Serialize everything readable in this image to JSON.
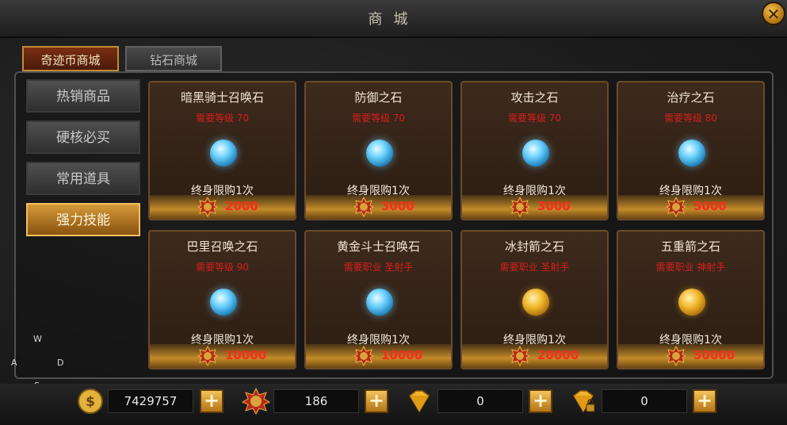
{
  "window": {
    "title": "商城"
  },
  "tabs": [
    {
      "label": "奇迹币商城",
      "active": true
    },
    {
      "label": "钻石商城",
      "active": false
    }
  ],
  "sidebar": {
    "items": [
      {
        "label": "热销商品",
        "active": false
      },
      {
        "label": "硬核必买",
        "active": false
      },
      {
        "label": "常用道具",
        "active": false
      },
      {
        "label": "强力技能",
        "active": true
      }
    ]
  },
  "items": [
    {
      "name": "暗黑骑士召唤石",
      "requirement": "需要等级 70",
      "gem": "blue-gem-icon",
      "limit": "终身限购1次",
      "price": "2000"
    },
    {
      "name": "防御之石",
      "requirement": "需要等级 70",
      "gem": "blue-gem-icon",
      "limit": "终身限购1次",
      "price": "3000"
    },
    {
      "name": "攻击之石",
      "requirement": "需要等级 70",
      "gem": "blue-gem-icon",
      "limit": "终身限购1次",
      "price": "3000"
    },
    {
      "name": "治疗之石",
      "requirement": "需要等级 80",
      "gem": "blue-gem-icon",
      "limit": "终身限购1次",
      "price": "5000"
    },
    {
      "name": "巴里召唤之石",
      "requirement": "需要等级 90",
      "gem": "blue-gem-icon",
      "limit": "终身限购1次",
      "price": "10000"
    },
    {
      "name": "黄金斗士召唤石",
      "requirement": "需要职业 圣射手",
      "gem": "blue-gem-icon",
      "limit": "终身限购1次",
      "price": "10000"
    },
    {
      "name": "冰封箭之石",
      "requirement": "需要职业 圣射手",
      "gem": "gold-gem-icon",
      "limit": "终身限购1次",
      "price": "20000"
    },
    {
      "name": "五重箭之石",
      "requirement": "需要职业 神射手",
      "gem": "gold-gem-icon",
      "limit": "终身限购1次",
      "price": "50000"
    }
  ],
  "compass": {
    "n": "W",
    "w": "A",
    "e": "D",
    "s": "S"
  },
  "currencies": [
    {
      "icon": "gold-coin-icon",
      "value": "7429757"
    },
    {
      "icon": "miracle-coin-icon",
      "value": "186"
    },
    {
      "icon": "diamond-icon",
      "value": "0"
    },
    {
      "icon": "locked-diamond-icon",
      "value": "0"
    }
  ],
  "colors": {
    "price": "#ff2a1a",
    "requirement": "#d81e1e",
    "accent": "#c48a2a"
  }
}
